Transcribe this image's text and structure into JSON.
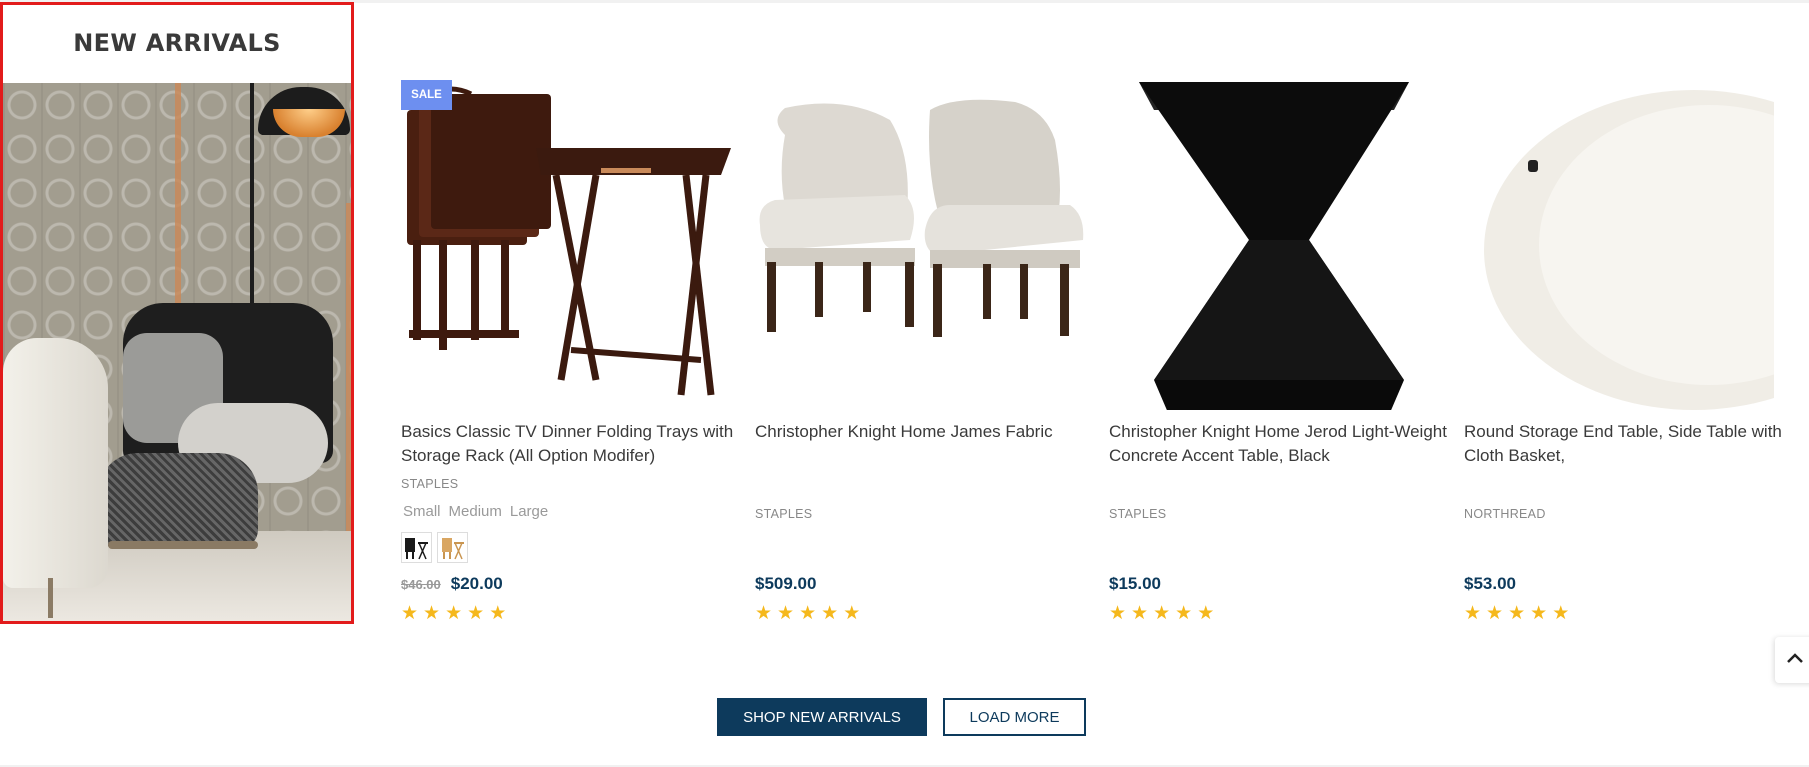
{
  "section": {
    "title": "NEW ARRIVALS"
  },
  "products": [
    {
      "title": "Basics Classic TV Dinner Folding Trays with Storage Rack (All Option Modifer)",
      "brand": "STAPLES",
      "badge": "SALE",
      "sizes": [
        "Small",
        "Medium",
        "Large"
      ],
      "swatches": [
        "black",
        "natural"
      ],
      "old_price": "$46.00",
      "price": "$20.00",
      "rating": 5
    },
    {
      "title": "Christopher Knight Home James Fabric",
      "brand": "STAPLES",
      "price": "$509.00",
      "rating": 5
    },
    {
      "title": "Christopher Knight Home Jerod Light-Weight Concrete Accent Table, Black",
      "brand": "STAPLES",
      "price": "$15.00",
      "rating": 5
    },
    {
      "title": "Round Storage End Table, Side Table with Cloth Basket,",
      "brand": "NORTHREAD",
      "price": "$53.00",
      "rating": 5
    }
  ],
  "actions": {
    "shop_label": "SHOP NEW ARRIVALS",
    "load_more_label": "LOAD MORE"
  },
  "icons": {
    "star": "star-icon",
    "scroll_top": "chevron-up-icon"
  },
  "colors": {
    "accent": "#0d3a5c",
    "sale_badge": "#6d8ff0",
    "star": "#f5b81c",
    "highlight_border": "#e21b1b"
  }
}
